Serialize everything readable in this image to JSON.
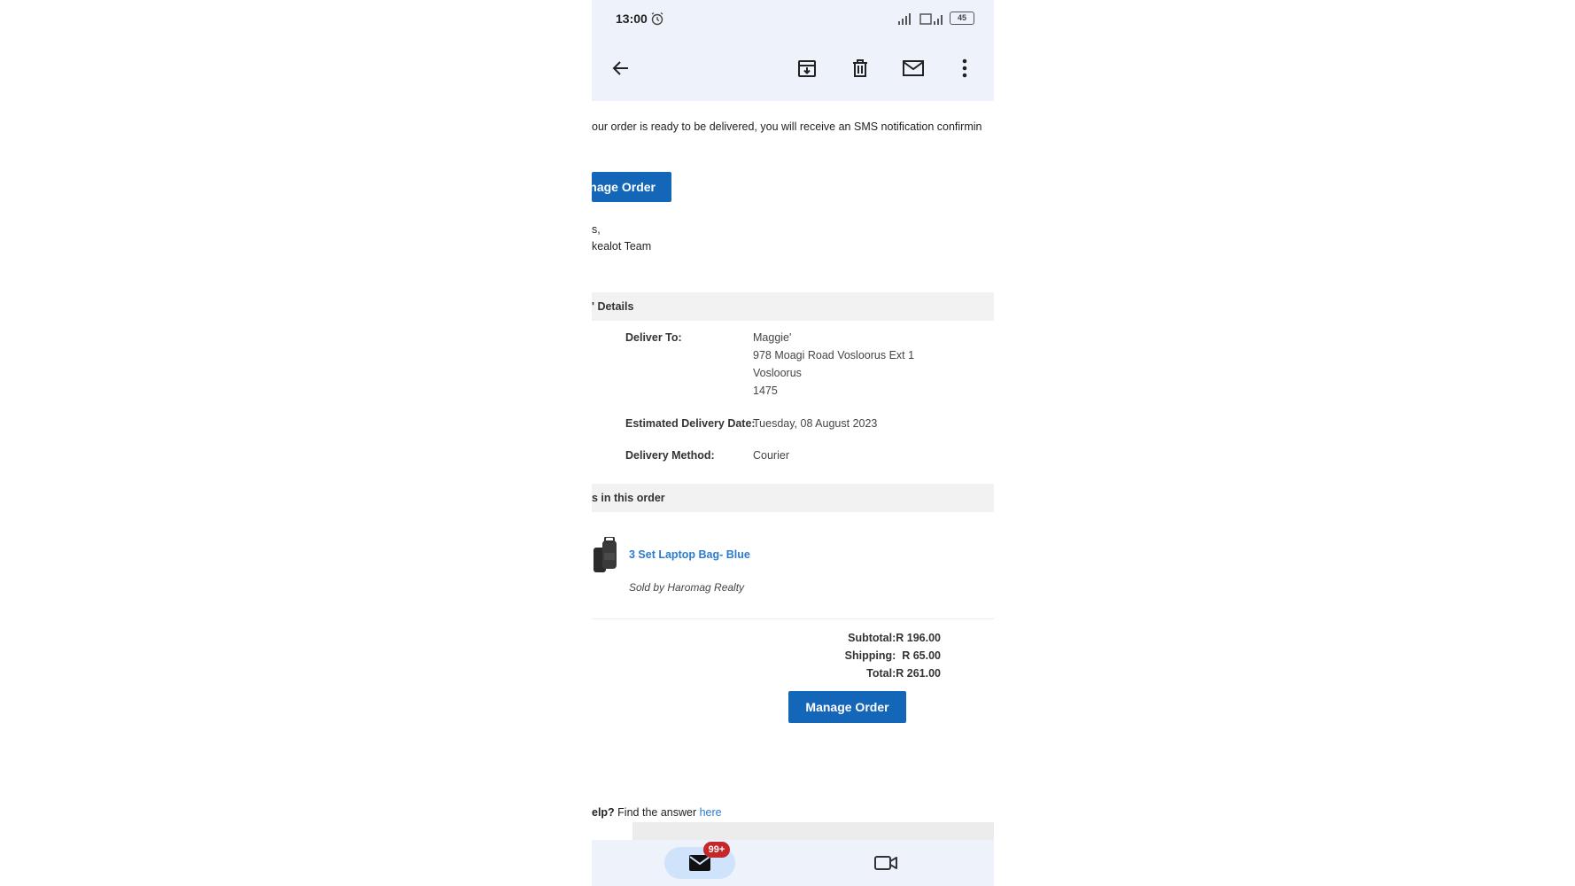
{
  "status_bar": {
    "time": "13:00",
    "battery": "45",
    "icons": [
      "alarm-icon",
      "signal-icon",
      "wifi-icon",
      "battery-icon"
    ]
  },
  "toolbar": {
    "icons": [
      "back-arrow-icon",
      "archive-icon",
      "trash-icon",
      "mail-icon",
      "more-vert-icon"
    ]
  },
  "email": {
    "intro_text": "our order is ready to be delivered, you will receive an SMS notification confirmin",
    "manage_order_top": "nage Order",
    "signoff_line1": "s,",
    "signoff_line2": "kealot Team",
    "details_header": "' Details",
    "deliver_to_label": "Deliver To:",
    "deliver_to_name": "Maggie'",
    "deliver_to_street": "978 Moagi Road Vosloorus Ext 1",
    "deliver_to_suburb": "Vosloorus",
    "deliver_to_code": "1475",
    "est_date_label": "Estimated Delivery Date:",
    "est_date_value": "Tuesday, 08 August 2023",
    "method_label": "Delivery Method:",
    "method_value": "Courier",
    "items_header": "s in this order",
    "product_name": "3 Set Laptop Bag- Blue",
    "product_seller": "Sold by Haromag Realty",
    "subtotal": "Subtotal:R 196.00",
    "shipping": "Shipping:  R 65.00",
    "total": "Total:R 261.00",
    "manage_order_bottom": "Manage Order",
    "help_prefix": "elp?",
    "help_text": " Find the answer ",
    "help_link": "here"
  },
  "bottom_nav": {
    "badge": "99+",
    "icons": [
      "mail-icon",
      "video-icon"
    ]
  },
  "colors": {
    "accent": "#1467b8",
    "link": "#2a7ccd",
    "badge": "#c5282a",
    "chrome_bg": "#eef3fb"
  }
}
